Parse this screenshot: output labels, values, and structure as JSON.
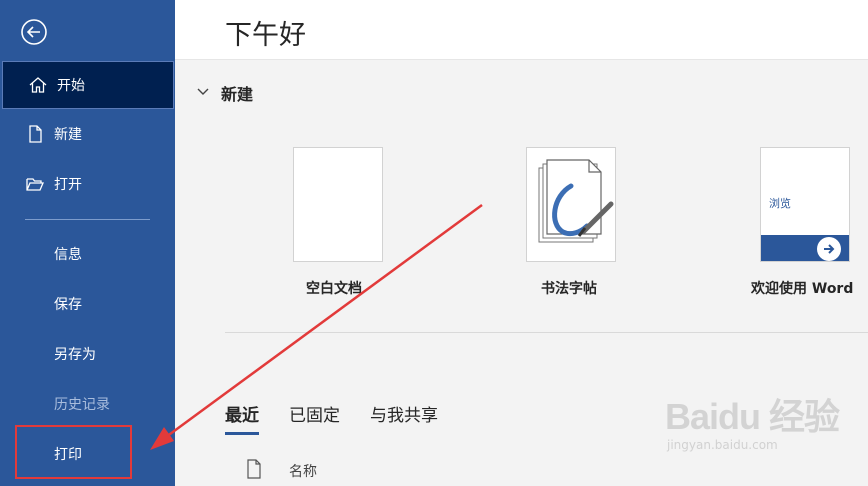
{
  "sidebar": {
    "items": [
      {
        "label": "开始",
        "icon": "home-icon"
      },
      {
        "label": "新建",
        "icon": "new-document-icon"
      },
      {
        "label": "打开",
        "icon": "folder-open-icon"
      },
      {
        "label": "信息"
      },
      {
        "label": "保存"
      },
      {
        "label": "另存为"
      },
      {
        "label": "历史记录"
      },
      {
        "label": "打印"
      }
    ]
  },
  "header": {
    "greeting": "下午好"
  },
  "new_section": {
    "label": "新建",
    "templates": [
      {
        "name": "空白文档"
      },
      {
        "name": "书法字帖"
      },
      {
        "name": "欢迎使用 Word",
        "thumb_text": "浏览"
      }
    ]
  },
  "tabs": [
    {
      "label": "最近"
    },
    {
      "label": "已固定"
    },
    {
      "label": "与我共享"
    }
  ],
  "file_list": {
    "column_name": "名称"
  },
  "watermark": {
    "brand": "Baidu 经验",
    "url": "jingyan.baidu.com"
  },
  "colors": {
    "sidebar": "#2b579a",
    "active": "#002050",
    "annotation": "#e23a3a"
  }
}
